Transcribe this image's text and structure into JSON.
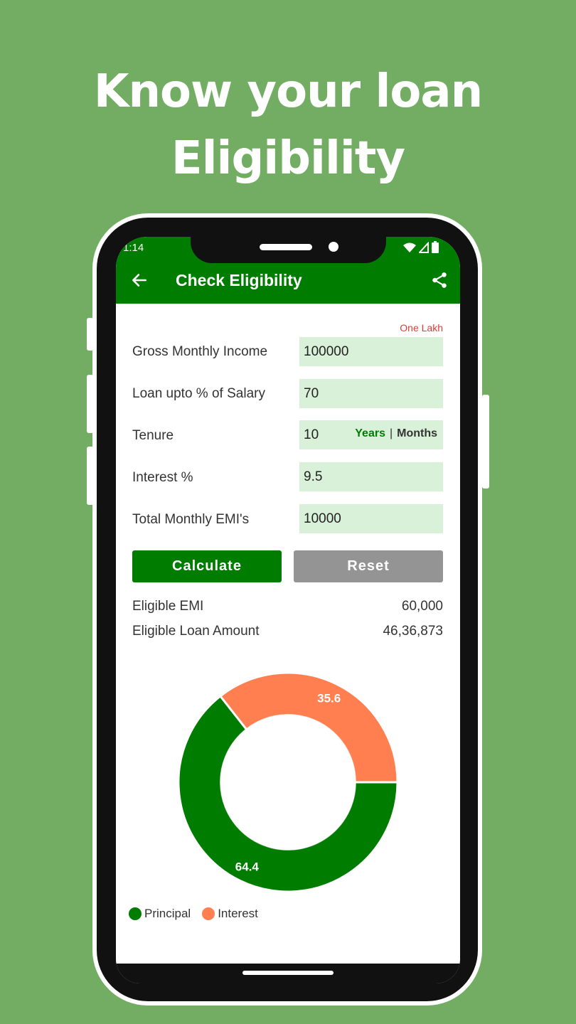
{
  "headline": {
    "line1": "Know your loan",
    "line2": "Eligibility"
  },
  "status": {
    "time": "1:14"
  },
  "appbar": {
    "title": "Check Eligibility",
    "back_icon": "arrow-left-icon",
    "share_icon": "share-icon"
  },
  "form": {
    "hint": "One Lakh",
    "rows": [
      {
        "label": "Gross Monthly Income",
        "value": "100000"
      },
      {
        "label": "Loan upto % of Salary",
        "value": "70"
      },
      {
        "label": "Tenure",
        "value": "10",
        "toggle_years": "Years",
        "toggle_sep": "|",
        "toggle_months": "Months"
      },
      {
        "label": "Interest %",
        "value": "9.5"
      },
      {
        "label": "Total Monthly EMI's",
        "value": "10000"
      }
    ]
  },
  "buttons": {
    "calculate": "Calculate",
    "reset": "Reset"
  },
  "results": [
    {
      "label": "Eligible EMI",
      "value": "60,000"
    },
    {
      "label": "Eligible Loan Amount",
      "value": "46,36,873"
    }
  ],
  "colors": {
    "brand": "#007d00",
    "interest": "#ff7f50",
    "principal": "#007d00",
    "background": "#72ad63",
    "field_bg": "#d9f0d9"
  },
  "chart_data": {
    "type": "pie",
    "style": "donut",
    "slices": [
      {
        "label": "Principal",
        "value": 64.4,
        "color": "#007d00"
      },
      {
        "label": "Interest",
        "value": 35.6,
        "color": "#ff7f50"
      }
    ],
    "legend": [
      "Principal",
      "Interest"
    ],
    "legend_position": "bottom-left"
  }
}
